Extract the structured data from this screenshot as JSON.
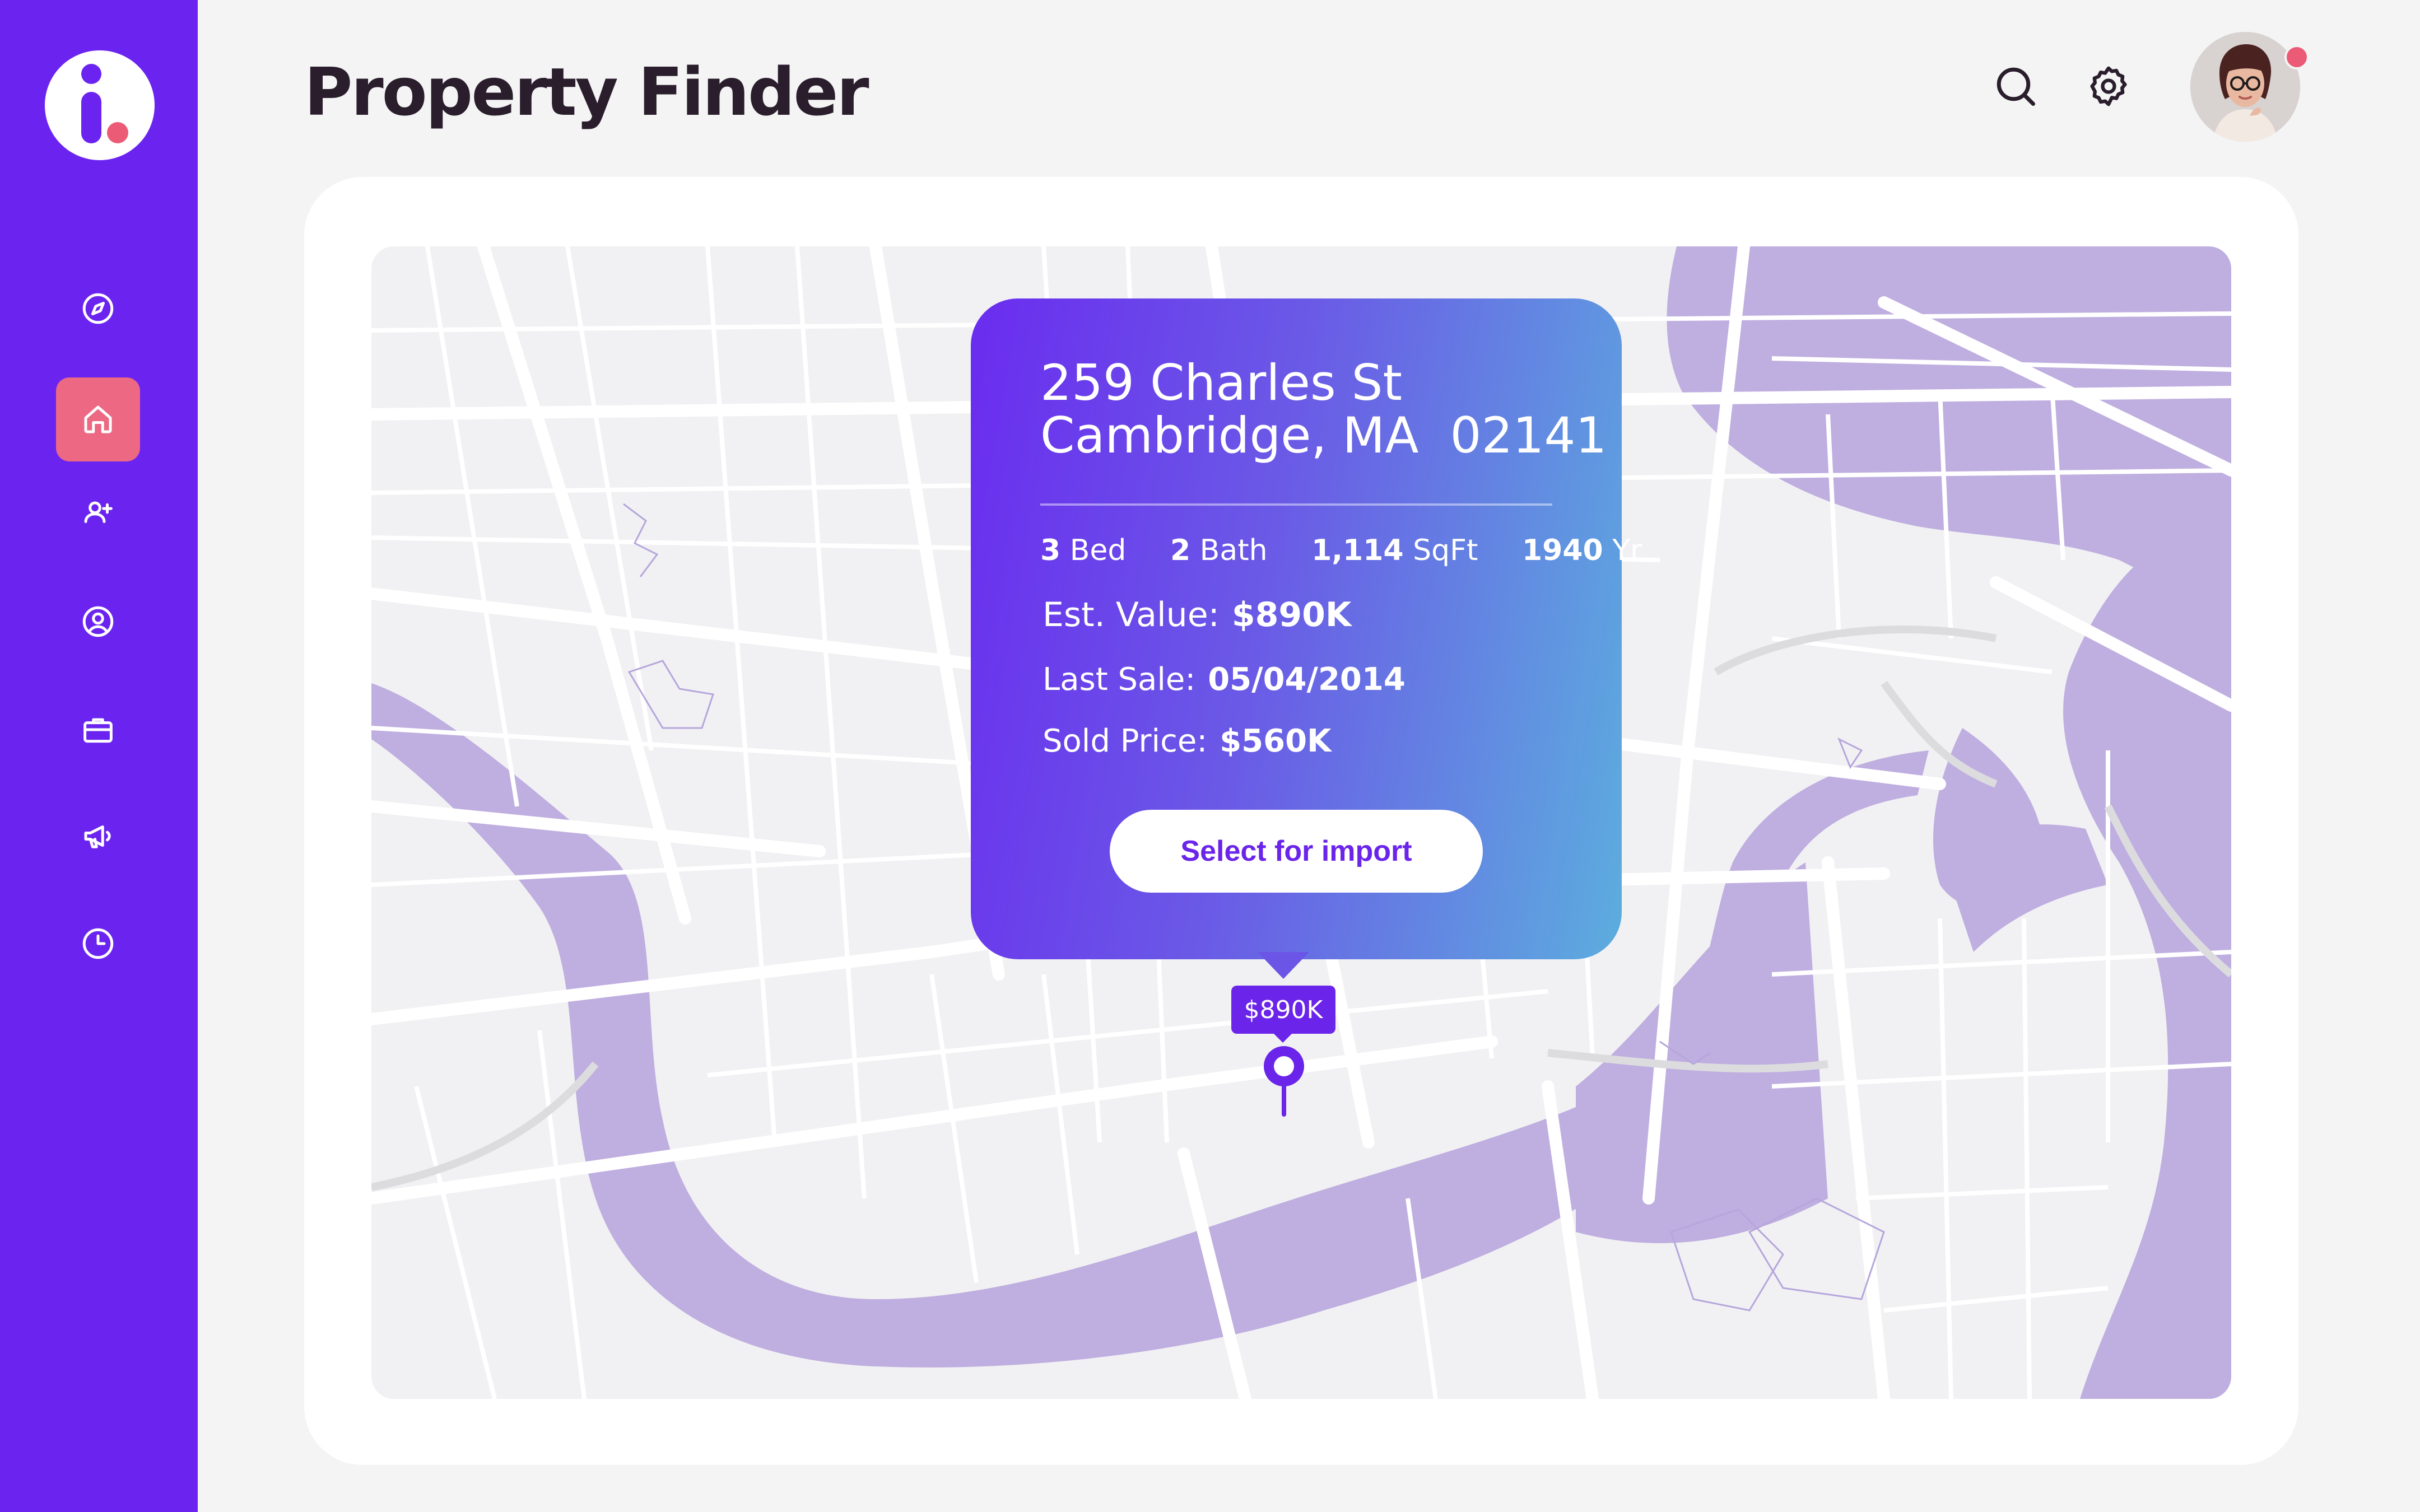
{
  "app": {
    "title": "Property Finder"
  },
  "sidebar": {
    "items": [
      {
        "name": "explore",
        "icon": "compass-icon",
        "active": false
      },
      {
        "name": "home",
        "icon": "home-icon",
        "active": true
      },
      {
        "name": "add-user",
        "icon": "user-plus-icon",
        "active": false
      },
      {
        "name": "profile",
        "icon": "user-circle-icon",
        "active": false
      },
      {
        "name": "portfolio",
        "icon": "briefcase-icon",
        "active": false
      },
      {
        "name": "campaigns",
        "icon": "megaphone-icon",
        "active": false
      },
      {
        "name": "history",
        "icon": "clock-icon",
        "active": false
      }
    ]
  },
  "header": {
    "search_icon": "search-icon",
    "settings_icon": "gear-icon",
    "avatar_has_notification": true
  },
  "property": {
    "address_line1": "259 Charles St",
    "address_line2": "Cambridge, MA  02141",
    "beds": "3",
    "beds_label": "Bed",
    "baths": "2",
    "baths_label": "Bath",
    "sqft": "1,114",
    "sqft_label": "SqFt",
    "year": "1940",
    "year_label": "Yr",
    "est_value_label": "Est. Value:",
    "est_value": "$890K",
    "last_sale_label": "Last Sale:",
    "last_sale": "05/04/2014",
    "sold_price_label": "Sold Price:",
    "sold_price": "$560K",
    "import_button": "Select for import",
    "pin_price": "$890K"
  },
  "colors": {
    "brand_purple": "#6b24f0",
    "accent_pink": "#ec6883",
    "water": "#bfaee0",
    "gradient_start": "#6a2cef",
    "gradient_end": "#5cadde"
  }
}
